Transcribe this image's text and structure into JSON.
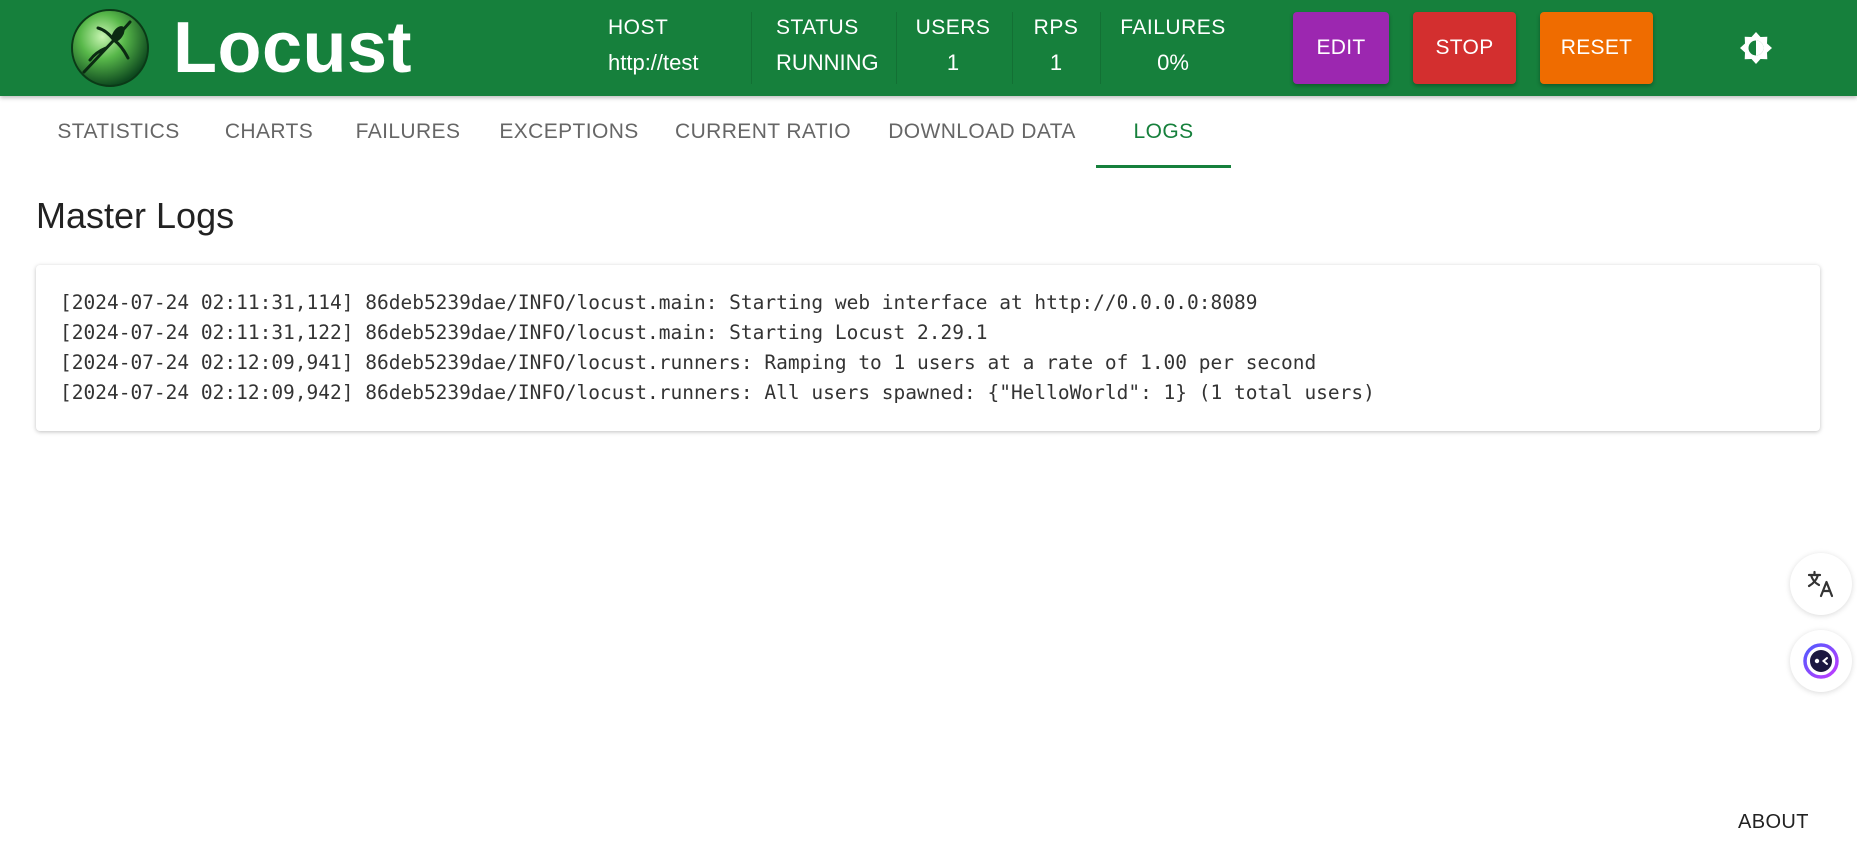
{
  "header": {
    "brand": "Locust",
    "stats": [
      {
        "label": "HOST",
        "value": "http://test"
      },
      {
        "label": "STATUS",
        "value": "RUNNING"
      },
      {
        "label": "USERS",
        "value": "1"
      },
      {
        "label": "RPS",
        "value": "1"
      },
      {
        "label": "FAILURES",
        "value": "0%"
      }
    ],
    "buttons": {
      "edit": "EDIT",
      "stop": "STOP",
      "reset": "RESET"
    },
    "colors": {
      "header_bg": "#16803c",
      "edit": "#9c27b0",
      "stop": "#d32f2f",
      "reset": "#ef6c00"
    },
    "theme_icon": "brightness-icon"
  },
  "tabs": [
    {
      "label": "STATISTICS"
    },
    {
      "label": "CHARTS"
    },
    {
      "label": "FAILURES"
    },
    {
      "label": "EXCEPTIONS"
    },
    {
      "label": "CURRENT RATIO"
    },
    {
      "label": "DOWNLOAD DATA"
    },
    {
      "label": "LOGS",
      "active": true
    }
  ],
  "main": {
    "title": "Master Logs",
    "logs": [
      "[2024-07-24 02:11:31,114] 86deb5239dae/INFO/locust.main: Starting web interface at http://0.0.0.0:8089",
      "[2024-07-24 02:11:31,122] 86deb5239dae/INFO/locust.main: Starting Locust 2.29.1",
      "[2024-07-24 02:12:09,941] 86deb5239dae/INFO/locust.runners: Ramping to 1 users at a rate of 1.00 per second",
      "[2024-07-24 02:12:09,942] 86deb5239dae/INFO/locust.runners: All users spawned: {\"HelloWorld\": 1} (1 total users)"
    ]
  },
  "floating": {
    "translate_icon": "translate-icon",
    "assistant_icon": "assistant-icon"
  },
  "footer": {
    "about": "ABOUT"
  }
}
